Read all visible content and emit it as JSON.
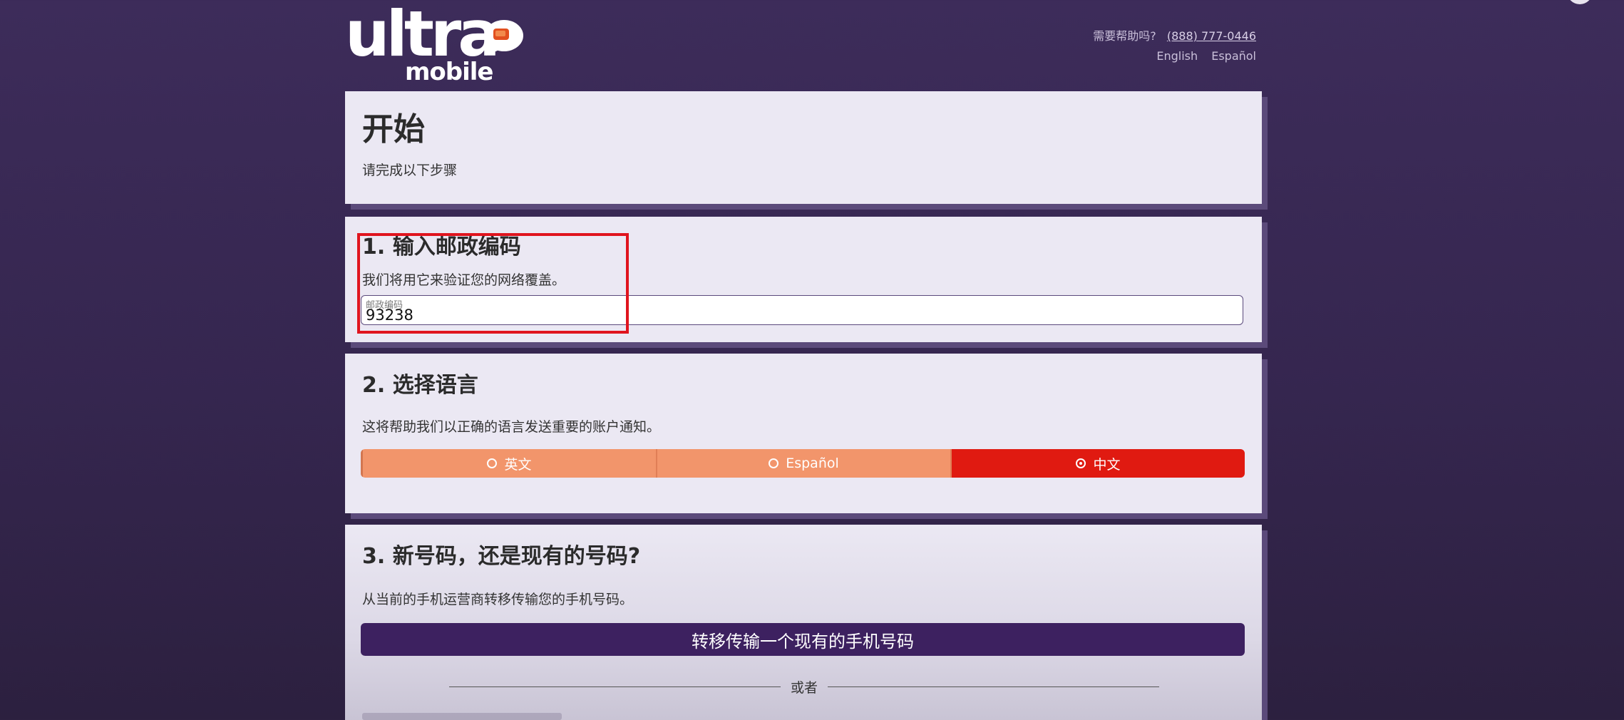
{
  "header": {
    "logo_top": "ultra",
    "logo_bottom": "mobile",
    "help_label": "需要帮助吗?",
    "help_phone": "(888) 777-0446",
    "lang_english": "English",
    "lang_spanish": "Español"
  },
  "intro": {
    "title": "开始",
    "subtitle": "请完成以下步骤"
  },
  "step1": {
    "title": "1. 输入邮政编码",
    "description": "我们将用它来验证您的网络覆盖。",
    "field_label": "邮政编码",
    "field_value": "93238"
  },
  "step2": {
    "title": "2. 选择语言",
    "description": "这将帮助我们以正确的语言发送重要的账户通知。",
    "options": [
      {
        "label": "英文",
        "selected": false
      },
      {
        "label": "Español",
        "selected": false
      },
      {
        "label": "中文",
        "selected": true
      }
    ]
  },
  "step3": {
    "title": "3. 新号码，还是现有的号码?",
    "description": "从当前的手机运营商转移传输您的手机号码。",
    "transfer_button": "转移传输一个现有的手机号码",
    "or_label": "或者"
  },
  "colors": {
    "background": "#3d2c5a",
    "card": "#ebe8f3",
    "toggle": "#f2956b",
    "toggle_selected": "#e01a11",
    "primary_button": "#3d2160",
    "highlight": "#e0141e"
  }
}
